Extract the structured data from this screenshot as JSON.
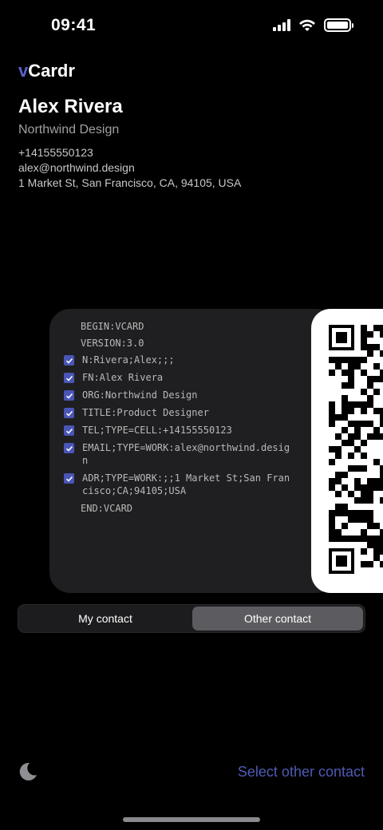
{
  "status": {
    "time": "09:41"
  },
  "app": {
    "brand_prefix": "v",
    "brand_rest": "Cardr"
  },
  "contact": {
    "name": "Alex Rivera",
    "org": "Northwind Design",
    "phone": "+14155550123",
    "email": "alex@northwind.design",
    "address": "1 Market St, San Francisco, CA, 94105, USA"
  },
  "vcard": {
    "begin": "BEGIN:VCARD",
    "version": "VERSION:3.0",
    "fields": [
      {
        "text": "N:Rivera;Alex;;;",
        "checked": true
      },
      {
        "text": "FN:Alex Rivera",
        "checked": true
      },
      {
        "text": "ORG:Northwind Design",
        "checked": true
      },
      {
        "text": "TITLE:Product Designer",
        "checked": true
      },
      {
        "text": "TEL;TYPE=CELL:+14155550123",
        "checked": true
      },
      {
        "text": "EMAIL;TYPE=WORK:alex@northwind.design",
        "checked": true
      },
      {
        "text": "ADR;TYPE=WORK:;;1 Market St;San Francisco;CA;94105;USA",
        "checked": true
      }
    ],
    "end": "END:VCARD"
  },
  "segment": {
    "left": "My contact",
    "right": "Other contact",
    "selected": "Other contact"
  },
  "footer": {
    "select_link": "Select other contact"
  },
  "colors": {
    "accent": "#4f5bb5",
    "checkbox": "#4a55b8",
    "background": "#000000"
  },
  "icons": {
    "theme_toggle": "moon-icon",
    "wifi": "wifi-icon",
    "signal": "signal-icon",
    "battery": "battery-icon",
    "qr": "qr-code-icon"
  }
}
